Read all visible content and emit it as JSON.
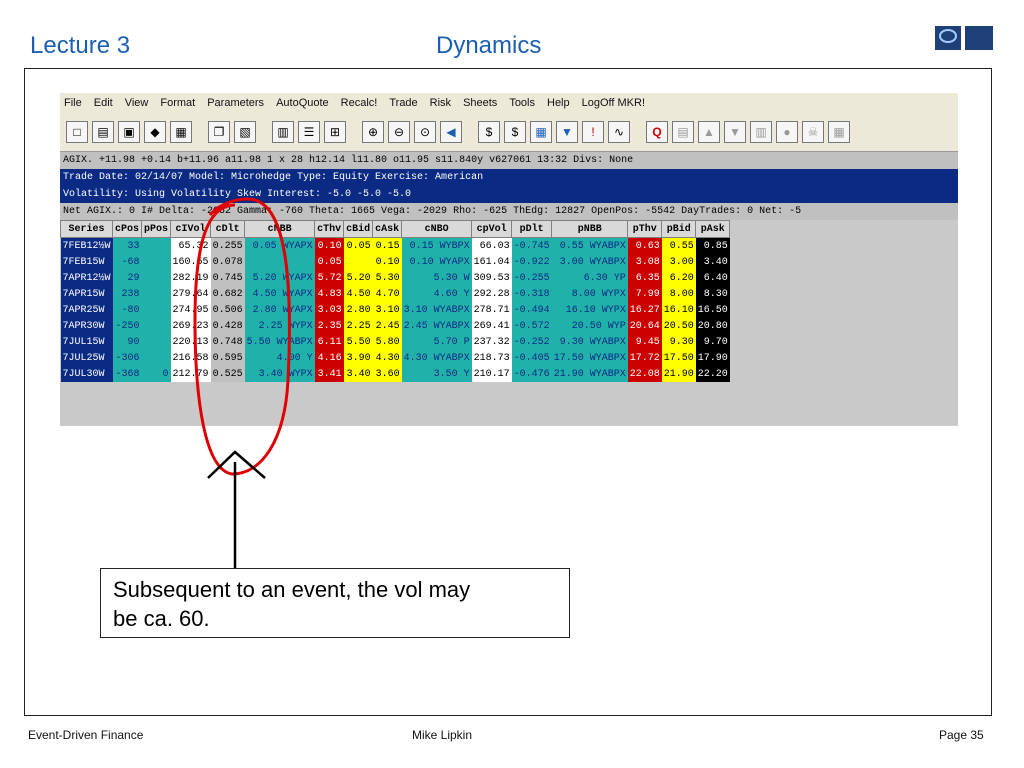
{
  "slide": {
    "title_left": "Lecture 3",
    "title_center": "Dynamics",
    "footer_left": "Event-Driven Finance",
    "footer_mid": "Mike Lipkin",
    "footer_right": "Page 35"
  },
  "menu": [
    "File",
    "Edit",
    "View",
    "Format",
    "Parameters",
    "AutoQuote",
    "Recalc!",
    "Trade",
    "Risk",
    "Sheets",
    "Tools",
    "Help",
    "LogOff MKR!"
  ],
  "toolbar": {
    "icons": [
      "new-icon",
      "open-icon",
      "save-icon",
      "print-icon",
      "print-setup-icon",
      "copy-icon",
      "paste-icon",
      "grid-icon",
      "list-icon",
      "matrix-icon",
      "zoom-in-icon",
      "zoom-out-icon",
      "zoom-icon",
      "back-icon",
      "dollar-icon",
      "dollar-edit-icon",
      "calculator-icon",
      "filter-icon",
      "exclamation-icon",
      "chart-icon",
      "quote-icon"
    ]
  },
  "info_lines": {
    "line1": "AGIX. +11.98   +0.14 b+11.96 a11.98 1 x 28 h12.14 l11.80 o11.95 s11.840y   v627061 13:32 Divs: None",
    "line2": "Trade Date: 02/14/07   Model: Microhedge Type: Equity Exercise: American",
    "line3": "Volatility: Using Volatility Skew                  Interest: -5.0 -5.0 -5.0",
    "line4": "Net AGIX.: 0   I# Delta: -2052 Gamma: -760 Theta: 1665 Vega: -2029 Rho: -625 ThEdg: 12827 OpenPos: -5542 DayTrades: 0 Net: -5"
  },
  "table": {
    "headers": [
      "Series",
      "cPos",
      "pPos",
      "cIVol",
      "cDlt",
      "cNBB",
      "cThv",
      "cBid",
      "cAsk",
      "cNBO",
      "cpVol",
      "pDlt",
      "pNBB",
      "pThv",
      "pBid",
      "pAsk"
    ],
    "rows": [
      {
        "series": "7FEB12½W",
        "cPos": "33",
        "pPos": "",
        "cIVol": "65.32",
        "cDlt": "0.255",
        "cNBB": "0.05 WYAPX",
        "cThv": "0.10",
        "cBid": "0.05",
        "cAsk": "0.15",
        "cNBO": "0.15 WYBPX",
        "cpVol": "66.03",
        "pDlt": "-0.745",
        "pNBB": "0.55 WYABPX",
        "pThv": "0.63",
        "pBid": "0.55",
        "pAsk": "0.85"
      },
      {
        "series": "7FEB15W",
        "cPos": "-68",
        "pPos": "",
        "cIVol": "160.55",
        "cDlt": "0.078",
        "cNBB": "",
        "cThv": "0.05",
        "cBid": "",
        "cAsk": "0.10",
        "cNBO": "0.10 WYAPX",
        "cpVol": "161.04",
        "pDlt": "-0.922",
        "pNBB": "3.00 WYABPX",
        "pThv": "3.08",
        "pBid": "3.00",
        "pAsk": "3.40"
      },
      {
        "series": "7APR12½W",
        "cPos": "29",
        "pPos": "",
        "cIVol": "282.19",
        "cDlt": "0.745",
        "cNBB": "5.20 WYAPX",
        "cThv": "5.72",
        "cBid": "5.20",
        "cAsk": "5.30",
        "cNBO": "5.30 W",
        "cpVol": "309.53",
        "pDlt": "-0.255",
        "pNBB": "6.30 YP",
        "pThv": "6.35",
        "pBid": "6.20",
        "pAsk": "6.40"
      },
      {
        "series": "7APR15W",
        "cPos": "238",
        "pPos": "",
        "cIVol": "279.64",
        "cDlt": "0.682",
        "cNBB": "4.50 WYAPX",
        "cThv": "4.83",
        "cBid": "4.50",
        "cAsk": "4.70",
        "cNBO": "4.60 Y",
        "cpVol": "292.28",
        "pDlt": "-0.318",
        "pNBB": "8.00 WYPX",
        "pThv": "7.99",
        "pBid": "8.00",
        "pAsk": "8.30"
      },
      {
        "series": "7APR25W",
        "cPos": "-80",
        "pPos": "",
        "cIVol": "274.95",
        "cDlt": "0.506",
        "cNBB": "2.80 WYAPX",
        "cThv": "3.03",
        "cBid": "2.80",
        "cAsk": "3.10",
        "cNBO": "3.10 WYABPX",
        "cpVol": "278.71",
        "pDlt": "-0.494",
        "pNBB": "16.10 WYPX",
        "pThv": "16.27",
        "pBid": "16.10",
        "pAsk": "16.50"
      },
      {
        "series": "7APR30W",
        "cPos": "-250",
        "pPos": "",
        "cIVol": "269.23",
        "cDlt": "0.428",
        "cNBB": "2.25 WYPX",
        "cThv": "2.35",
        "cBid": "2.25",
        "cAsk": "2.45",
        "cNBO": "2.45 WYABPX",
        "cpVol": "269.41",
        "pDlt": "-0.572",
        "pNBB": "20.50 WYP",
        "pThv": "20.64",
        "pBid": "20.50",
        "pAsk": "20.80"
      },
      {
        "series": "7JUL15W",
        "cPos": "90",
        "pPos": "",
        "cIVol": "220.13",
        "cDlt": "0.748",
        "cNBB": "5.50 WYABPX",
        "cThv": "6.11",
        "cBid": "5.50",
        "cAsk": "5.80",
        "cNBO": "5.70 P",
        "cpVol": "237.32",
        "pDlt": "-0.252",
        "pNBB": "9.30 WYABPX",
        "pThv": "9.45",
        "pBid": "9.30",
        "pAsk": "9.70"
      },
      {
        "series": "7JUL25W",
        "cPos": "-306",
        "pPos": "",
        "cIVol": "216.58",
        "cDlt": "0.595",
        "cNBB": "4.00 Y",
        "cThv": "4.16",
        "cBid": "3.90",
        "cAsk": "4.30",
        "cNBO": "4.30 WYABPX",
        "cpVol": "218.73",
        "pDlt": "-0.405",
        "pNBB": "17.50 WYABPX",
        "pThv": "17.72",
        "pBid": "17.50",
        "pAsk": "17.90"
      },
      {
        "series": "7JUL30W",
        "cPos": "-368",
        "pPos": "0",
        "cIVol": "212.79",
        "cDlt": "0.525",
        "cNBB": "3.40 WYPX",
        "cThv": "3.41",
        "cBid": "3.40",
        "cAsk": "3.60",
        "cNBO": "3.50 Y",
        "cpVol": "210.17",
        "pDlt": "-0.476",
        "pNBB": "21.90 WYABPX",
        "pThv": "22.08",
        "pBid": "21.90",
        "pAsk": "22.20"
      }
    ]
  },
  "callout": {
    "line1": "Subsequent to an event, the vol may",
    "line2": "be ca. 60."
  },
  "colors": {
    "title_blue": "#1a5fb4",
    "annotation_red": "#e00000",
    "series_blue": "#0a2a84",
    "teal": "#20b2aa",
    "yellow": "#ffff00"
  }
}
